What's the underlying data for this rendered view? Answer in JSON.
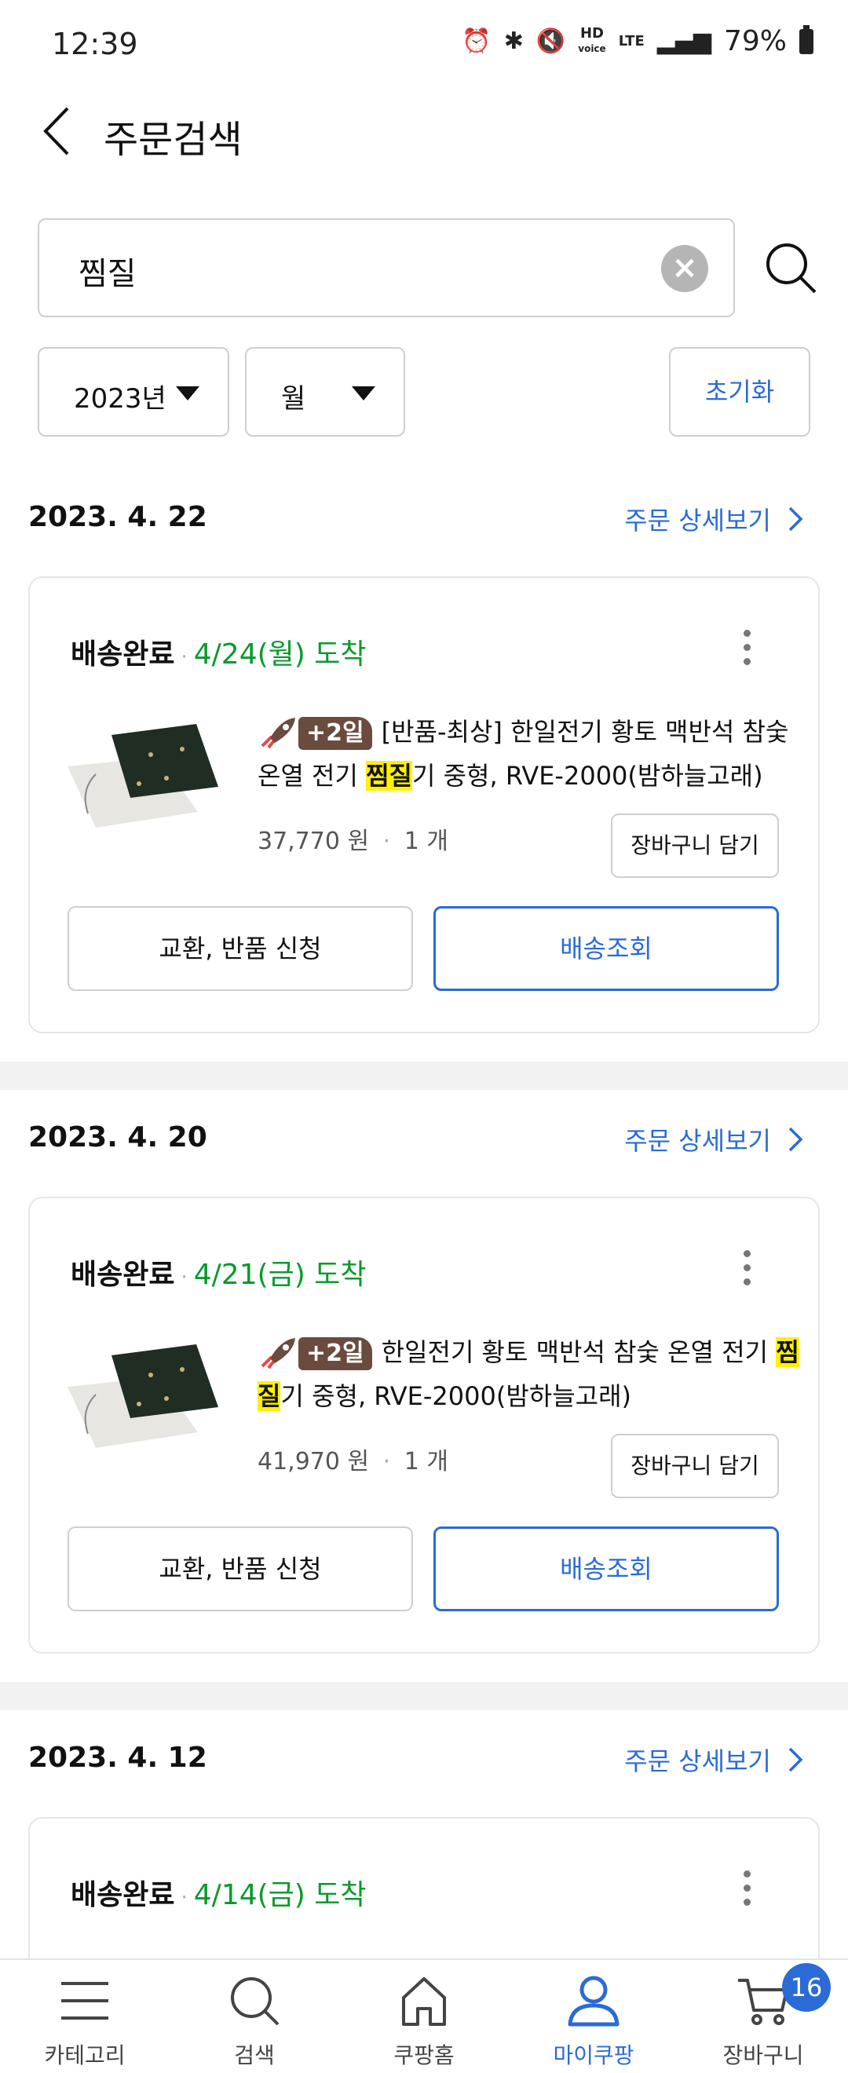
{
  "status_bar": {
    "time": "12:39",
    "battery": "79%",
    "hd_top": "HD",
    "hd_bottom": "voice",
    "lte": "LTE"
  },
  "header": {
    "title": "주문검색"
  },
  "search": {
    "value": "찜질"
  },
  "filters": {
    "year": "2023년",
    "month": "월",
    "reset": "초기화"
  },
  "detail_link_label": "주문 상세보기",
  "orders": [
    {
      "date": "2023. 4. 22",
      "status": "배송완료",
      "arrival": "4/24(월) 도착",
      "badge": "+2일",
      "title_pre": "[반품-최상] 한일전기 황토 맥반석 참숯 온열 전기 ",
      "title_hl": "찜질",
      "title_post": "기 중형, RVE-2000(밤하늘고래)",
      "price": "37,770 원",
      "qty": "1 개",
      "cart": "장바구니 담기",
      "btn_left": "교환, 반품 신청",
      "btn_right": "배송조회"
    },
    {
      "date": "2023. 4. 20",
      "status": "배송완료",
      "arrival": "4/21(금) 도착",
      "badge": "+2일",
      "title_pre": "한일전기 황토 맥반석 참숯 온열 전기 ",
      "title_hl": "찜질",
      "title_post": "기 중형, RVE-2000(밤하늘고래)",
      "price": "41,970 원",
      "qty": "1 개",
      "cart": "장바구니 담기",
      "btn_left": "교환, 반품 신청",
      "btn_right": "배송조회"
    },
    {
      "date": "2023. 4. 12",
      "status": "배송완료",
      "arrival": "4/14(금) 도착"
    }
  ],
  "nav": {
    "items": [
      {
        "label": "카테고리",
        "icon": "menu-icon"
      },
      {
        "label": "검색",
        "icon": "search-icon"
      },
      {
        "label": "쿠팡홈",
        "icon": "home-icon"
      },
      {
        "label": "마이쿠팡",
        "icon": "user-icon",
        "active": true
      },
      {
        "label": "장바구니",
        "icon": "cart-icon"
      }
    ],
    "cart_count": "16"
  },
  "colors": {
    "accent": "#2a6bd6",
    "arrival": "#0a9a2c",
    "highlight": "#fff200",
    "badge": "#6b4b3e"
  }
}
